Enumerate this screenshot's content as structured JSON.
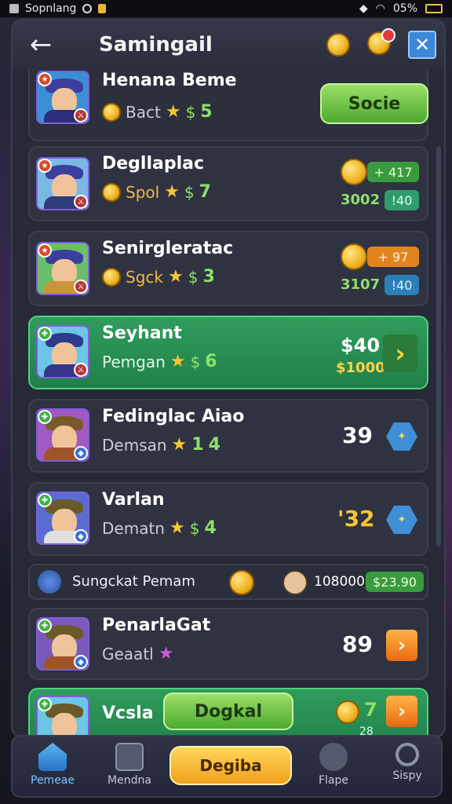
{
  "statusbar": {
    "carrier": "Sopnlang",
    "battery": "05%"
  },
  "header": {
    "title": "Samingail",
    "back_icon": "back-arrow-icon"
  },
  "rows": [
    {
      "name": "Henana Beme",
      "sub": "Bact",
      "level": "5",
      "action": "Socie"
    },
    {
      "name": "Degllaplac",
      "sub": "Spol",
      "level": "7",
      "pill1": "+ 417",
      "pill2_left": "3002",
      "pill2_right": "!40"
    },
    {
      "name": "Senirgleratac",
      "sub": "Sgck",
      "level": "3",
      "pill1": "+ 97",
      "pill2_left": "3107",
      "pill2_right": "!40"
    },
    {
      "name": "Seyhant",
      "sub": "Pemgan",
      "level": "6",
      "top_value": "$40",
      "bottom_value": "$1000"
    },
    {
      "name": "Fedinglac Aiao",
      "sub": "Demsan",
      "level": "4",
      "stars": "1",
      "value": "39"
    },
    {
      "name": "Varlan",
      "sub": "Dematn",
      "level": "4",
      "value": "'32"
    },
    {
      "name": "PenarlaGat",
      "sub": "Geaatl",
      "value": "89"
    },
    {
      "name": "Vcsla",
      "action": "Dogkal",
      "value": "7",
      "sub_value": "28"
    }
  ],
  "summary": {
    "label": "Sungckat Pemam",
    "amount": "108000",
    "pill": "$23.90"
  },
  "bottomnav": {
    "items": [
      "Pemeae",
      "Mendna",
      "Flape",
      "Sispy"
    ],
    "center": "Degiba"
  },
  "colors": {
    "accent_green": "#4da82f",
    "accent_orange": "#f0a11c",
    "panel": "#272a36"
  }
}
